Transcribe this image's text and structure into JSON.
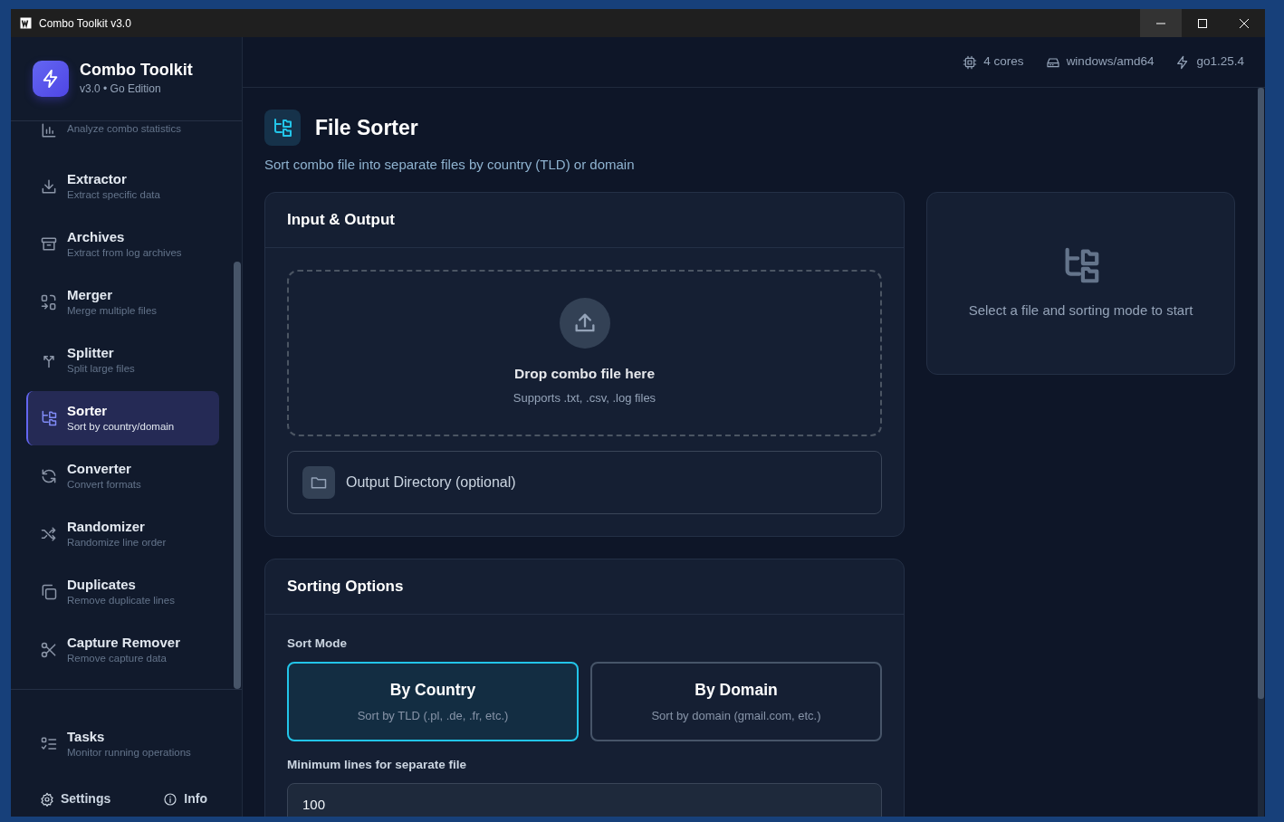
{
  "window": {
    "title": "Combo Toolkit v3.0"
  },
  "brand": {
    "name": "Combo Toolkit",
    "subtitle": "v3.0 • Go Edition"
  },
  "sidebar": {
    "items": [
      {
        "description": "Analyze combo statistics",
        "selected": false
      },
      {
        "title": "Extractor",
        "description": "Extract specific data",
        "selected": false
      },
      {
        "title": "Archives",
        "description": "Extract from log archives",
        "selected": false
      },
      {
        "title": "Merger",
        "description": "Merge multiple files",
        "selected": false
      },
      {
        "title": "Splitter",
        "description": "Split large files",
        "selected": false
      },
      {
        "title": "Sorter",
        "description": "Sort by country/domain",
        "selected": true
      },
      {
        "title": "Converter",
        "description": "Convert formats",
        "selected": false
      },
      {
        "title": "Randomizer",
        "description": "Randomize line order",
        "selected": false
      },
      {
        "title": "Duplicates",
        "description": "Remove duplicate lines",
        "selected": false
      },
      {
        "title": "Capture Remover",
        "description": "Remove capture data",
        "selected": false
      }
    ],
    "tasks": {
      "title": "Tasks",
      "description": "Monitor running operations"
    },
    "links": [
      "Settings",
      "Info"
    ]
  },
  "header": {
    "stats": [
      "4 cores",
      "windows/amd64",
      "go1.25.4"
    ]
  },
  "page": {
    "title": "File Sorter",
    "subtitle": "Sort combo file into separate files by country (TLD) or domain"
  },
  "input_output": {
    "title": "Input & Output",
    "dropzone": {
      "title": "Drop combo file here",
      "hint": "Supports .txt, .csv, .log files"
    },
    "output_directory": {
      "placeholder": "Output Directory (optional)"
    }
  },
  "sorting_options": {
    "title": "Sorting Options",
    "sort_mode_label": "Sort Mode",
    "modes": [
      {
        "title": "By Country",
        "description": "Sort by TLD (.pl, .de, .fr, etc.)",
        "selected": true
      },
      {
        "title": "By Domain",
        "description": "Sort by domain (gmail.com, etc.)",
        "selected": false
      }
    ],
    "min_lines": {
      "label": "Minimum lines for separate file",
      "value": "100"
    }
  },
  "status_panel": {
    "message": "Select a file and sorting mode to start"
  }
}
